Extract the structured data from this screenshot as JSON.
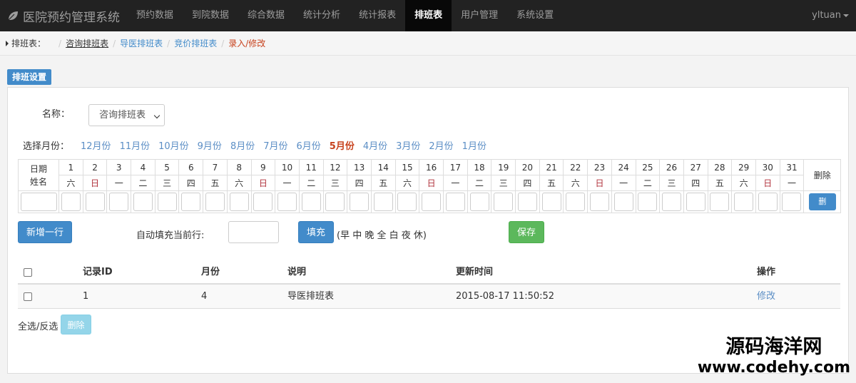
{
  "navbar": {
    "brand": "医院预约管理系统",
    "items": [
      "预约数据",
      "到院数据",
      "综合数据",
      "统计分析",
      "统计报表",
      "排班表",
      "用户管理",
      "系统设置"
    ],
    "active": "排班表",
    "user": "yltuan"
  },
  "breadcrumb": {
    "label": "排班表：",
    "links": [
      "咨询排班表",
      "导医排班表",
      "竞价排班表"
    ],
    "active": "录入/修改"
  },
  "section_label": "排班设置",
  "form": {
    "name_label": "名称：",
    "name_value": "咨询排班表",
    "month_label": "选择月份：",
    "months": [
      "12月份",
      "11月份",
      "10月份",
      "9月份",
      "8月份",
      "7月份",
      "6月份",
      "5月份",
      "4月份",
      "3月份",
      "2月份",
      "1月份"
    ],
    "active_month": "5月份"
  },
  "grid": {
    "corner_top": "日期",
    "corner_bottom": "姓名",
    "delete_header": "删除",
    "days": [
      "1",
      "2",
      "3",
      "4",
      "5",
      "6",
      "7",
      "8",
      "9",
      "10",
      "11",
      "12",
      "13",
      "14",
      "15",
      "16",
      "17",
      "18",
      "19",
      "20",
      "21",
      "22",
      "23",
      "24",
      "25",
      "26",
      "27",
      "28",
      "29",
      "30",
      "31"
    ],
    "weekdays": [
      "六",
      "日",
      "一",
      "二",
      "三",
      "四",
      "五",
      "六",
      "日",
      "一",
      "二",
      "三",
      "四",
      "五",
      "六",
      "日",
      "一",
      "二",
      "三",
      "四",
      "五",
      "六",
      "日",
      "一",
      "二",
      "三",
      "四",
      "五",
      "六",
      "日",
      "一"
    ],
    "row_delete_button": "删"
  },
  "actions": {
    "add_row": "新增一行",
    "autofill_label": "自动填充当前行:",
    "autofill_value": "",
    "fill_button": "填充",
    "fill_hint": "(早 中 晚 全 白 夜 休)",
    "save_button": "保存"
  },
  "records": {
    "columns": [
      "记录ID",
      "月份",
      "说明",
      "更新时间",
      "操作"
    ],
    "rows": [
      {
        "id": "1",
        "month": "4",
        "desc": "导医排班表",
        "updated": "2015-08-17 11:50:52",
        "action": "修改"
      }
    ]
  },
  "footer": {
    "select_all": "全选/反选",
    "delete_button": "删除"
  },
  "watermark": {
    "line1": "源码海洋网",
    "line2": "www.codehy.com"
  },
  "colors": {
    "navbar_bg": "#222222",
    "primary": "#428bca",
    "success": "#5cb85c",
    "active_month": "#c7411c",
    "sunday": "#b0303a"
  }
}
